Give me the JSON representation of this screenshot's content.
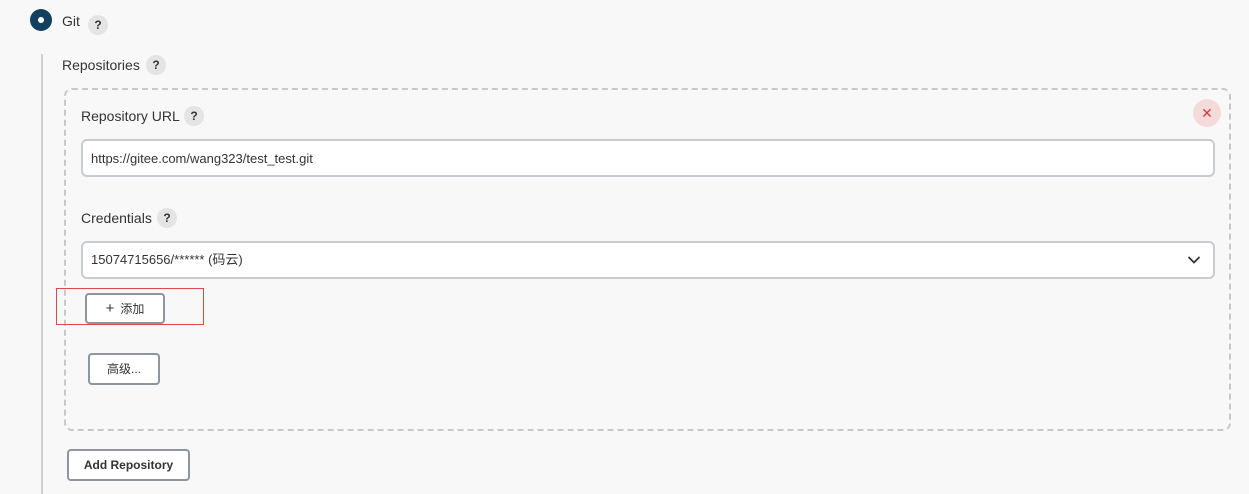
{
  "scm": {
    "option_label": "Git",
    "help_glyph": "?"
  },
  "repositories": {
    "label": "Repositories",
    "help_glyph": "?",
    "remove_glyph": "✕",
    "url": {
      "label": "Repository URL",
      "help_glyph": "?",
      "value": "https://gitee.com/wang323/test_test.git"
    },
    "credentials": {
      "label": "Credentials",
      "help_glyph": "?",
      "selected": "15074715656/****** (码云)",
      "add_button_icon": "+",
      "add_button_label": "添加"
    },
    "advanced_button_label": "高级...",
    "add_repository_label": "Add Repository"
  },
  "colors": {
    "radio_selected": "#14405f",
    "highlight_border": "#e04848",
    "remove_button_bg": "#f5dada",
    "remove_button_fg": "#d23b3b"
  },
  "icons": {
    "radio": "radio-selected-icon",
    "help": "help-icon",
    "remove": "close-icon",
    "dropdown": "chevron-down-icon",
    "add": "plus-icon"
  }
}
